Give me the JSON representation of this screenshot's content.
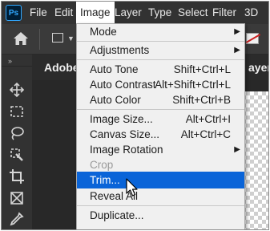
{
  "app": {
    "logo_text": "Ps"
  },
  "menubar": {
    "items": [
      "File",
      "Edit",
      "Image",
      "Layer",
      "Type",
      "Select",
      "Filter",
      "3D"
    ],
    "active": "Image"
  },
  "toolbar": {
    "icons": [
      "home-icon",
      "rectangle-shape-icon",
      "chevron-down-icon"
    ],
    "collapse_glyph": "»"
  },
  "tools": [
    "move-icon",
    "marquee-icon",
    "lasso-icon",
    "quick-selection-icon",
    "crop-icon",
    "frame-icon",
    "eyedropper-icon"
  ],
  "document": {
    "tab_title": "Adobe",
    "tab_right_fragment": "ayer"
  },
  "image_menu": {
    "items": [
      {
        "label": "Mode",
        "submenu": true
      },
      {
        "label": "Adjustments",
        "submenu": true
      },
      {
        "label": "Auto Tone",
        "shortcut": "Shift+Ctrl+L"
      },
      {
        "label": "Auto Contrast",
        "shortcut": "Alt+Shift+Ctrl+L"
      },
      {
        "label": "Auto Color",
        "shortcut": "Shift+Ctrl+B"
      },
      {
        "label": "Image Size...",
        "shortcut": "Alt+Ctrl+I"
      },
      {
        "label": "Canvas Size...",
        "shortcut": "Alt+Ctrl+C"
      },
      {
        "label": "Image Rotation",
        "submenu": true
      },
      {
        "label": "Crop",
        "disabled": true
      },
      {
        "label": "Trim...",
        "highlighted": true
      },
      {
        "label": "Reveal All"
      },
      {
        "label": "Duplicate..."
      }
    ]
  },
  "colors": {
    "menubar_bg": "#323232",
    "menu_bg": "#f0f0f0",
    "highlight": "#0a64d8",
    "ps_logo_blue": "#31a8ff",
    "ps_logo_bg": "#001e36"
  }
}
